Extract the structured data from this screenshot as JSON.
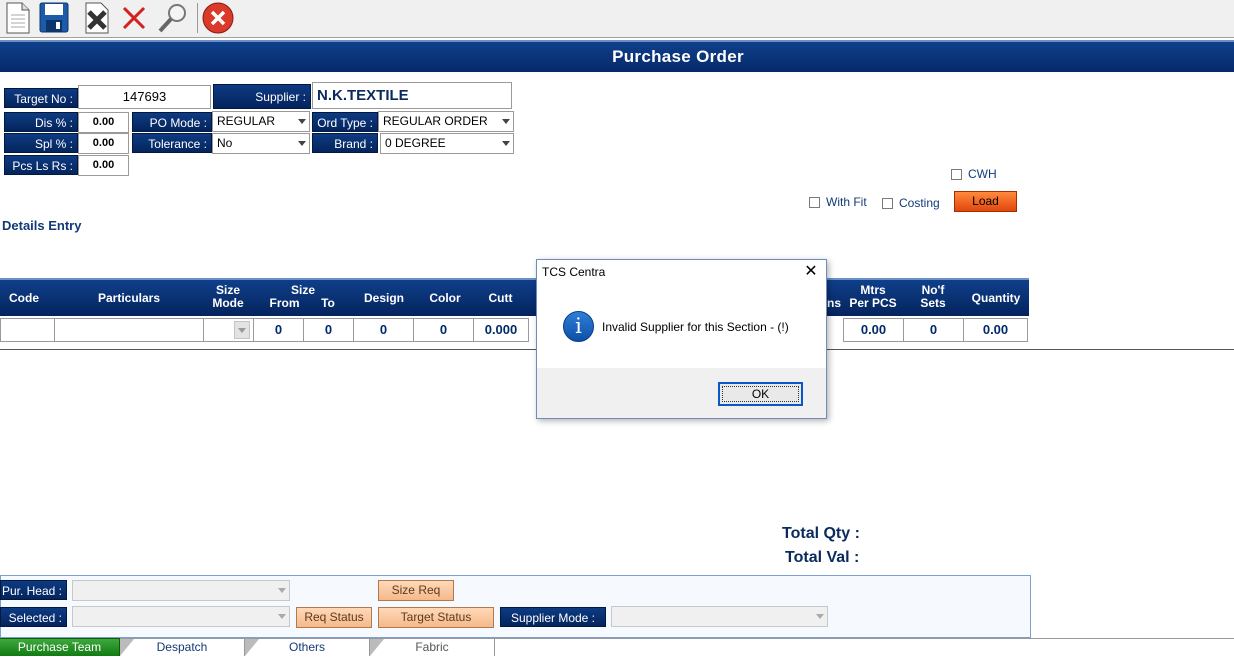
{
  "toolbar": {
    "icons": [
      "new-icon",
      "save-icon",
      "delete-icon",
      "cancel-icon",
      "find-icon",
      "exit-icon"
    ]
  },
  "window_title": "Purchase Order",
  "header": {
    "target_no_label": "Target No :",
    "target_no_value": "147693",
    "supplier_label": "Supplier :",
    "supplier_value": "N.K.TEXTILE",
    "dis_label": "Dis % :",
    "dis_value": "0.00",
    "po_mode_label": "PO Mode :",
    "po_mode_value": "REGULAR",
    "ord_type_label": "Ord Type :",
    "ord_type_value": "REGULAR ORDER",
    "spl_label": "Spl % :",
    "spl_value": "0.00",
    "tolerance_label": "Tolerance :",
    "tolerance_value": "No",
    "brand_label": "Brand  :",
    "brand_value": "0 DEGREE",
    "pcs_label": "Pcs Ls Rs :",
    "pcs_value": "0.00"
  },
  "options": {
    "cwh_label": "CWH",
    "with_fit_label": "With Fit",
    "costing_label": "Costing",
    "load_label": "Load"
  },
  "details_entry_label": "Details Entry",
  "grid": {
    "headers": {
      "code": "Code",
      "particulars": "Particulars",
      "size_mode_1": "Size",
      "size_mode_2": "Mode",
      "size": "Size",
      "from": "From",
      "to": "To",
      "design": "Design",
      "color": "Color",
      "cutt": "Cutt",
      "ns": "ns",
      "mtrs_1": "Mtrs",
      "mtrs_2": "Per PCS",
      "sets_1": "No'f",
      "sets_2": "Sets",
      "quantity": "Quantity"
    },
    "row": {
      "code": "",
      "particulars": "",
      "size_from": "0",
      "size_to": "0",
      "design": "0",
      "color": "0",
      "cutt": "0.000",
      "mtrs": "0.00",
      "sets": "0",
      "quantity": "0.00"
    }
  },
  "totals": {
    "qty_label": "Total Qty :",
    "val_label": "Total Val :"
  },
  "bottom": {
    "pur_head_label": "Pur. Head :",
    "selected_label": "Selected :",
    "size_req_label": "Size Req",
    "req_status_label": "Req Status",
    "target_status_label": "Target Status",
    "supplier_mode_label": "Supplier Mode :"
  },
  "tabs": [
    "Purchase Team",
    "Despatch",
    "Others",
    "Fabric"
  ],
  "dialog": {
    "title": "TCS Centra",
    "message": "Invalid Supplier for this Section - (!)",
    "ok_label": "OK",
    "icon_glyph": "i"
  }
}
